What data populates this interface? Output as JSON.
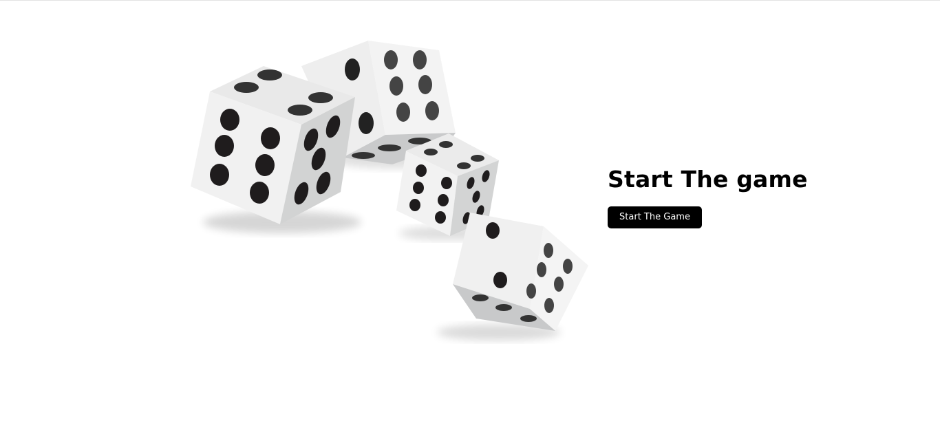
{
  "game": {
    "heading": "Start The game",
    "start_button_label": "Start The Game",
    "hero_image": "dice-icon",
    "colors": {
      "background": "#ffffff",
      "text": "#000000",
      "button_background": "#000000",
      "button_text": "#ffffff",
      "die_face_light": "#f1f1f1",
      "die_face_shade": "#d2d3d3",
      "pip": "#1f1c1d"
    }
  }
}
